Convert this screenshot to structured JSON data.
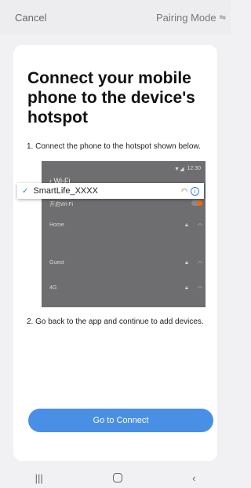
{
  "header": {
    "cancel": "Cancel",
    "mode": "Pairing Mode"
  },
  "card": {
    "title": "Connect your mobile phone to the device's hotspot",
    "step1": "1. Connect the phone to the hotspot shown below.",
    "step2": "2. Go back to the app and continue to add devices.",
    "button": "Go to Connect"
  },
  "illustration": {
    "status_time": "12:30",
    "wifi_title": "Wi-Fi",
    "row_enable": "开启Wi-Fi",
    "row_home": "Home",
    "row_guest": "Guest",
    "row_4g": "4G",
    "ssid": "SmartLife_XXXX",
    "toggle_color": "#f06a0a"
  },
  "colors": {
    "accent": "#4a8fe6"
  }
}
